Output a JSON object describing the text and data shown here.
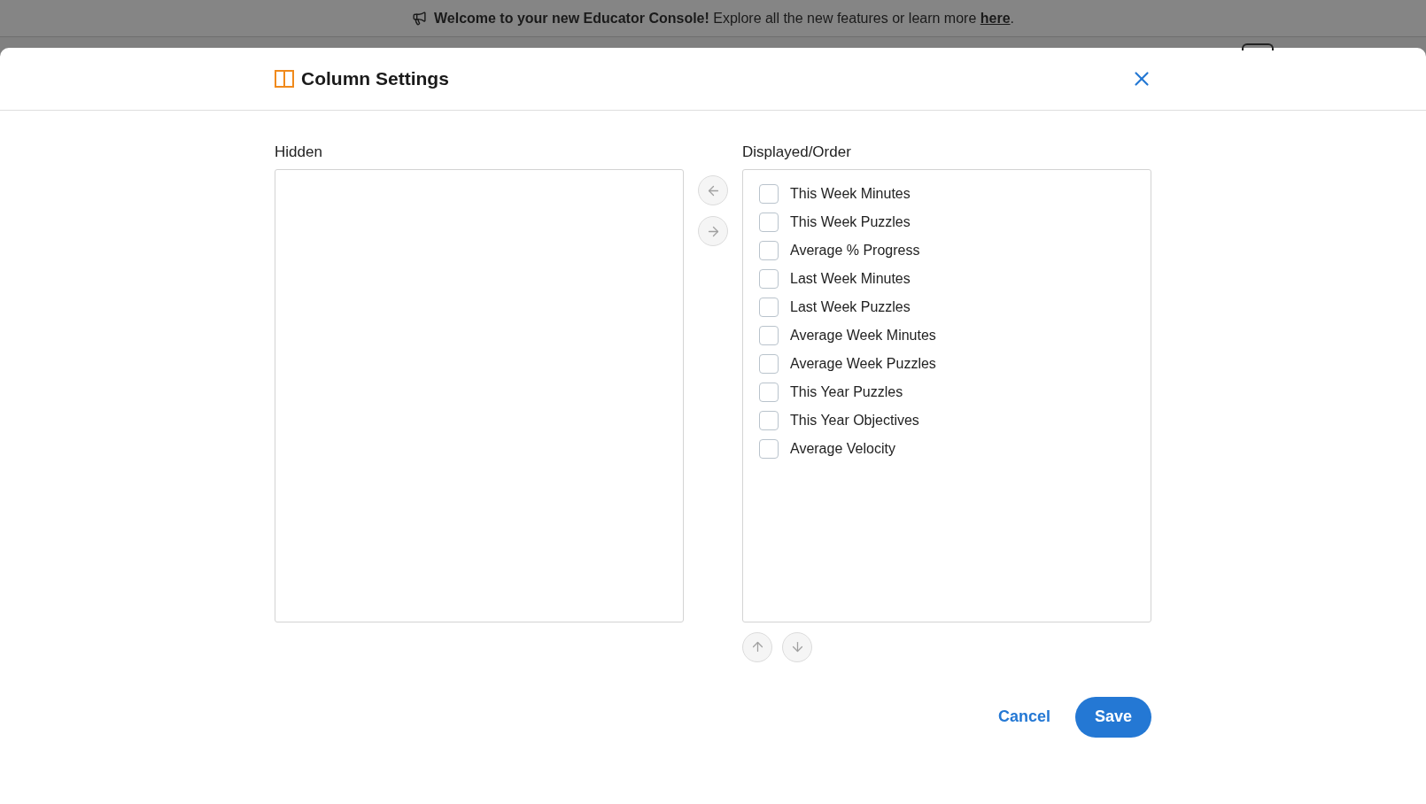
{
  "banner": {
    "message": "**Welcome to your new Educator Console!** Explore all the new features or learn more ",
    "link": "here",
    "after": "."
  },
  "dialog": {
    "title": "Column Settings",
    "hidden": {
      "label": "Hidden"
    },
    "move_buttons": [
      {
        "kind": "left",
        "disabled": true
      },
      {
        "kind": "right",
        "disabled": true
      }
    ],
    "displayed": {
      "label": "Displayed/Order",
      "items": [
        {
          "label": "This Week Minutes",
          "checked": false
        },
        {
          "label": "This Week Puzzles",
          "checked": false
        },
        {
          "label": "Average % Progress",
          "checked": false
        },
        {
          "label": "Last Week Minutes",
          "checked": false
        },
        {
          "label": "Last Week Puzzles",
          "checked": false
        },
        {
          "label": "Average Week Minutes",
          "checked": false
        },
        {
          "label": "Average Week Puzzles",
          "checked": false
        },
        {
          "label": "This Year Puzzles",
          "checked": false
        },
        {
          "label": "This Year Objectives",
          "checked": false
        },
        {
          "label": "Average Velocity",
          "checked": false
        }
      ]
    },
    "order_buttons": [
      {
        "kind": "up",
        "disabled": true
      },
      {
        "kind": "down",
        "disabled": true
      }
    ],
    "cancel": "Cancel",
    "save": "Save"
  }
}
